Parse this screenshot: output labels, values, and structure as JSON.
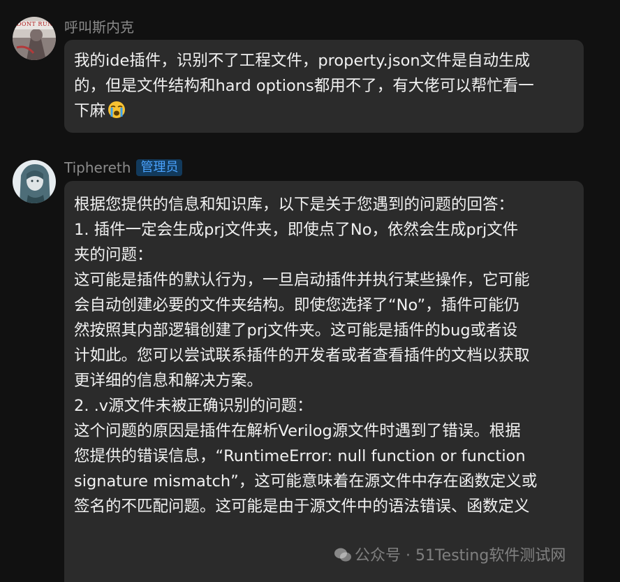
{
  "messages": [
    {
      "sender": "呼叫斯内克",
      "avatar_text": "DONT RUN",
      "lines": [
        "我的ide插件，识别不了工程文件，property.json文件是自动生成",
        "的，但是文件结构和hard options都用不了，有大佬可以帮忙看一",
        "下麻"
      ]
    },
    {
      "sender": "Tiphereth",
      "badge": "管理员",
      "lines": [
        "根据您提供的信息和知识库，以下是关于您遇到的问题的回答：",
        "",
        "1. 插件一定会生成prj文件夹，即使点了No，依然会生成prj文件",
        "夹的问题：",
        "这可能是插件的默认行为，一旦启动插件并执行某些操作，它可能",
        "会自动创建必要的文件夹结构。即使您选择了“No”，插件可能仍",
        "然按照其内部逻辑创建了prj文件夹。这可能是插件的bug或者设",
        "计如此。您可以尝试联系插件的开发者或者查看插件的文档以获取",
        "更详细的信息和解决方案。",
        "",
        "2. .v源文件未被正确识别的问题：",
        "这个问题的原因是插件在解析Verilog源文件时遇到了错误。根据",
        "您提供的错误信息，“RuntimeError: null function or function",
        "signature mismatch”，这可能意味着在源文件中存在函数定义或",
        "签名的不匹配问题。这可能是由于源文件中的语法错误、函数定义"
      ]
    }
  ],
  "watermark": {
    "text": "公众号 · 51Testing软件测试网"
  }
}
